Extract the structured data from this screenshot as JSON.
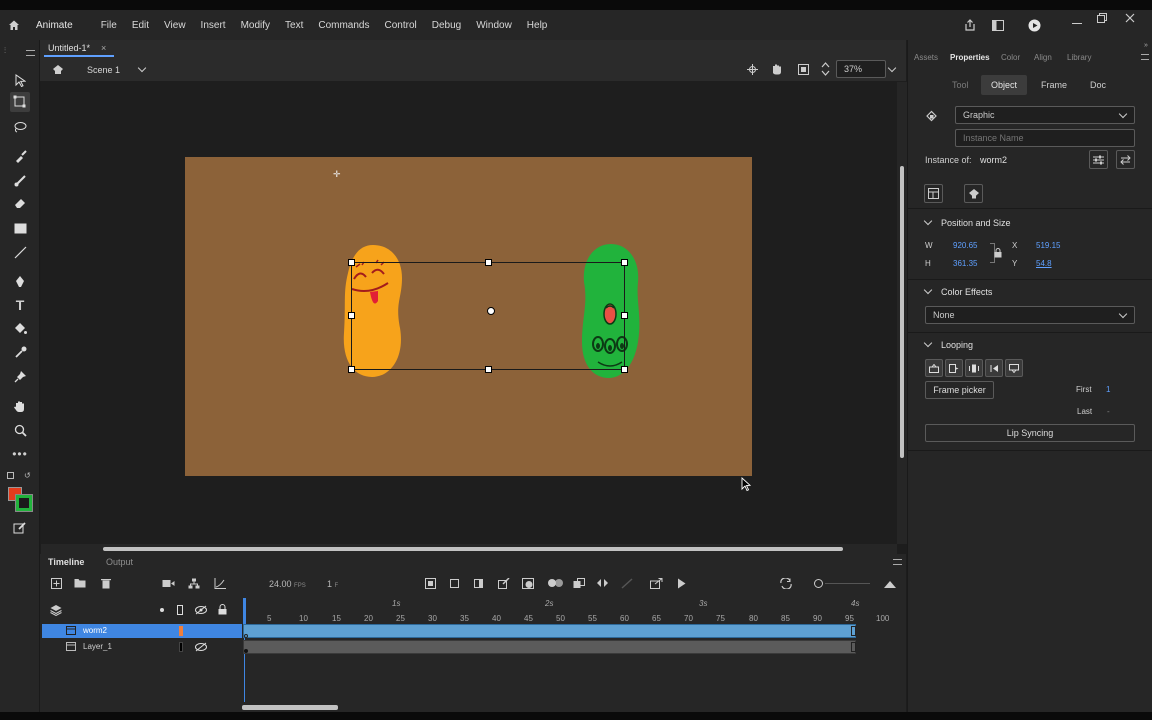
{
  "menubar": {
    "app_name": "Animate",
    "items": [
      "File",
      "Edit",
      "View",
      "Insert",
      "Modify",
      "Text",
      "Commands",
      "Control",
      "Debug",
      "Window",
      "Help"
    ]
  },
  "document": {
    "tab_title": "Untitled-1*",
    "scene": "Scene 1",
    "zoom": "37%"
  },
  "timeline": {
    "tabs": [
      "Timeline",
      "Output"
    ],
    "fps": "24.00",
    "fps_unit": "FPS",
    "frame": "1",
    "frame_unit": "F",
    "seconds": [
      "1s",
      "2s",
      "3s",
      "4s"
    ],
    "frame_numbers": [
      "5",
      "10",
      "15",
      "20",
      "25",
      "30",
      "35",
      "40",
      "45",
      "50",
      "55",
      "60",
      "65",
      "70",
      "75",
      "80",
      "85",
      "90",
      "95",
      "100"
    ],
    "layers": [
      {
        "name": "worm2",
        "selected": true,
        "color": "#f07f3c"
      },
      {
        "name": "Layer_1",
        "selected": false,
        "color": "#000000"
      }
    ]
  },
  "panel": {
    "tabs": [
      "Assets",
      "Properties",
      "Color",
      "Align",
      "Library"
    ],
    "subtabs": [
      "Tool",
      "Object",
      "Frame",
      "Doc"
    ],
    "symbol_type": "Graphic",
    "instance_name_placeholder": "Instance Name",
    "instance_of_label": "Instance of:",
    "instance_of_value": "worm2",
    "position_title": "Position and Size",
    "w_label": "W",
    "w_value": "920.65",
    "h_label": "H",
    "h_value": "361.35",
    "x_label": "X",
    "x_value": "519.15",
    "y_label": "Y",
    "y_value": "54.8",
    "color_effects_title": "Color Effects",
    "color_effect_value": "None",
    "looping_title": "Looping",
    "frame_picker": "Frame picker",
    "first_label": "First",
    "first_value": "1",
    "last_label": "Last",
    "last_value": "-",
    "lip_syncing": "Lip Syncing"
  },
  "colors": {
    "stage": "#8c6239",
    "accent_blue": "#5fa0ff",
    "worm_orange": "#f7a31b",
    "worm_green": "#21b33c"
  }
}
